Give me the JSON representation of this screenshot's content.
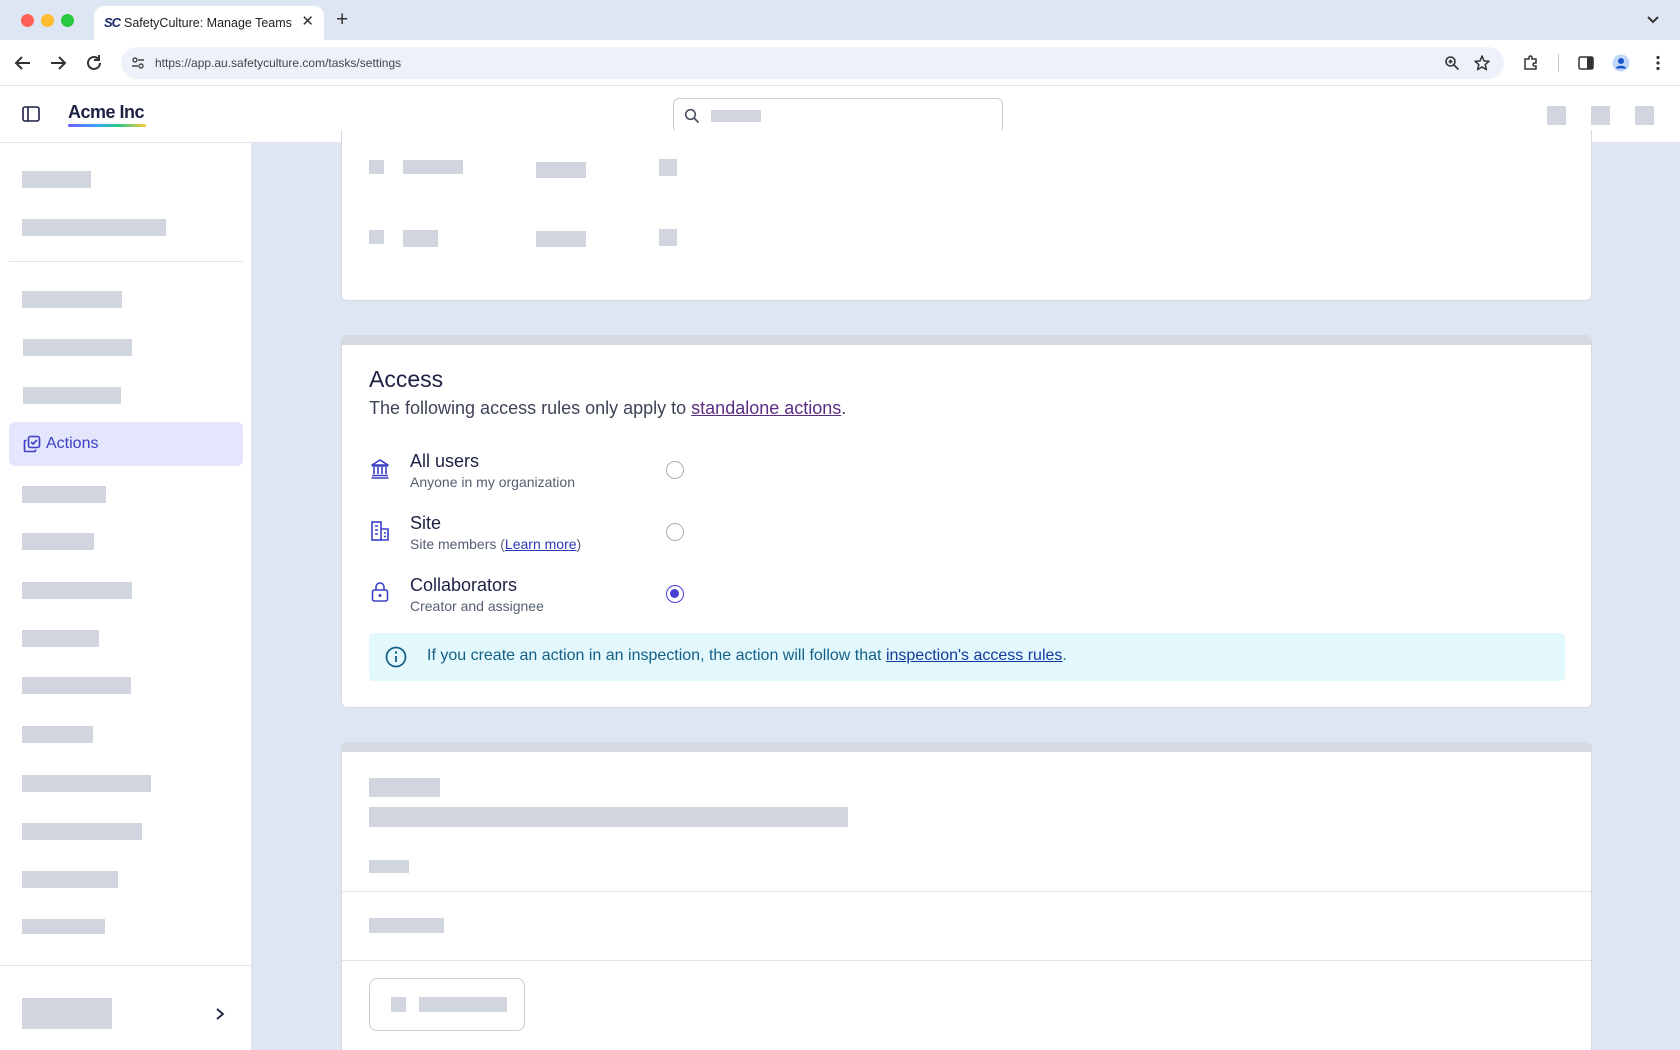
{
  "browser": {
    "tab_favicon": "SC",
    "tab_title": "SafetyCulture: Manage Teams and...",
    "tab_close": "✕",
    "new_tab": "+",
    "url": "https://app.au.safetyculture.com/tasks/settings"
  },
  "header": {
    "brand": "Acme Inc"
  },
  "sidebar": {
    "active_item": "Actions"
  },
  "access": {
    "title": "Access",
    "subtitle_prefix": "The following access rules only apply to ",
    "subtitle_link": "standalone actions",
    "subtitle_suffix": ".",
    "options": [
      {
        "title": "All users",
        "description": "Anyone in my organization",
        "icon": "bank-icon",
        "selected": false
      },
      {
        "title": "Site",
        "description_prefix": "Site members (",
        "description_link": "Learn more",
        "description_suffix": ")",
        "icon": "building-icon",
        "selected": false
      },
      {
        "title": "Collaborators",
        "description": "Creator and assignee",
        "icon": "lock-icon",
        "selected": true
      }
    ],
    "info_prefix": "If you create an action in an inspection, the action will follow that ",
    "info_link": "inspection's access rules",
    "info_suffix": "."
  },
  "colors": {
    "accent": "#4740d4",
    "active_nav_bg": "#e4e6fd",
    "info_bg": "#e3f8fd",
    "skeleton": "#d1d5de"
  }
}
